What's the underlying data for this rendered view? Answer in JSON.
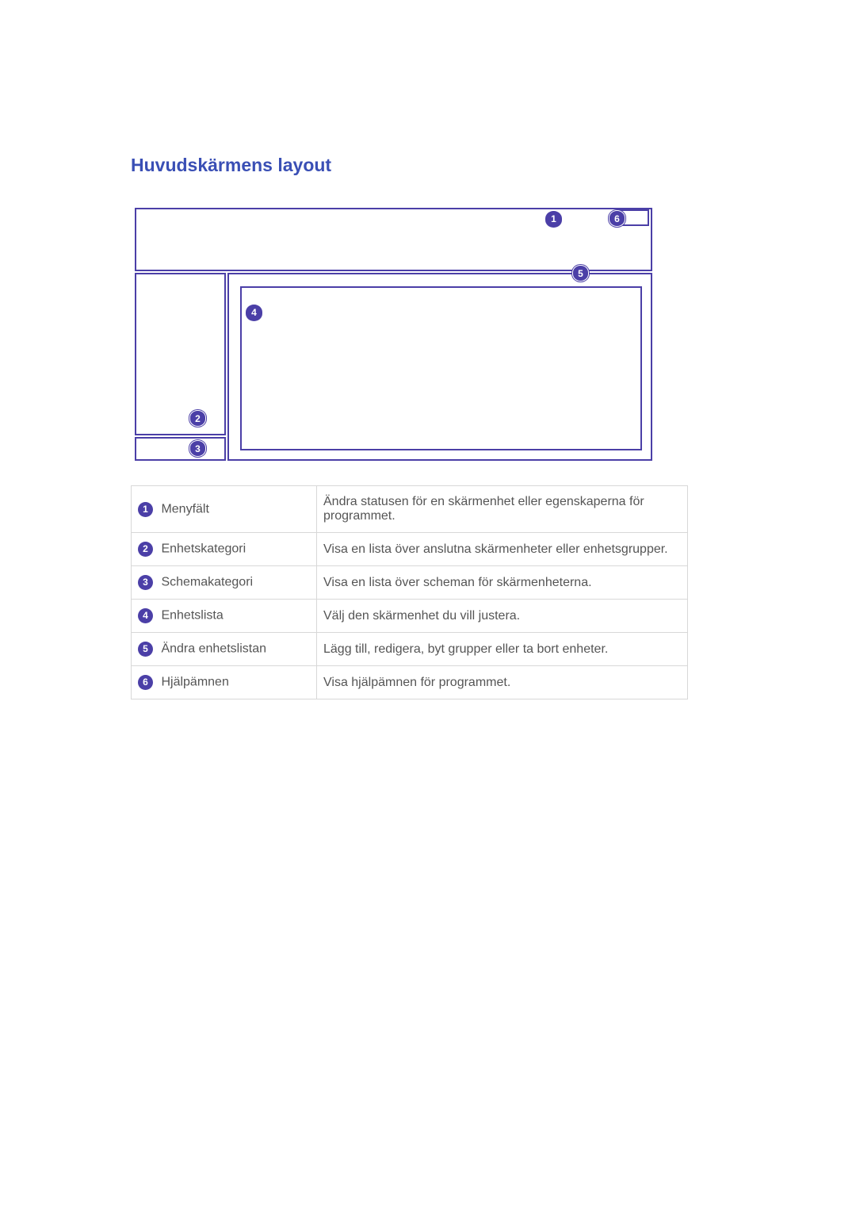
{
  "heading": "Huvudskärmens layout",
  "diagram_badges": [
    "1",
    "2",
    "3",
    "4",
    "5",
    "6"
  ],
  "legend": [
    {
      "num": "1",
      "label": "Menyfält",
      "desc": "Ändra statusen för en skärmenhet eller egenskaperna för programmet."
    },
    {
      "num": "2",
      "label": "Enhetskategori",
      "desc": "Visa en lista över anslutna skärmenheter eller enhetsgrupper."
    },
    {
      "num": "3",
      "label": "Schemakategori",
      "desc": "Visa en lista över scheman för skärmenheterna."
    },
    {
      "num": "4",
      "label": "Enhetslista",
      "desc": "Välj den skärmenhet du vill justera."
    },
    {
      "num": "5",
      "label": "Ändra enhetslistan",
      "desc": "Lägg till, redigera, byt grupper eller ta bort enheter."
    },
    {
      "num": "6",
      "label": "Hjälpämnen",
      "desc": "Visa hjälpämnen för programmet."
    }
  ]
}
